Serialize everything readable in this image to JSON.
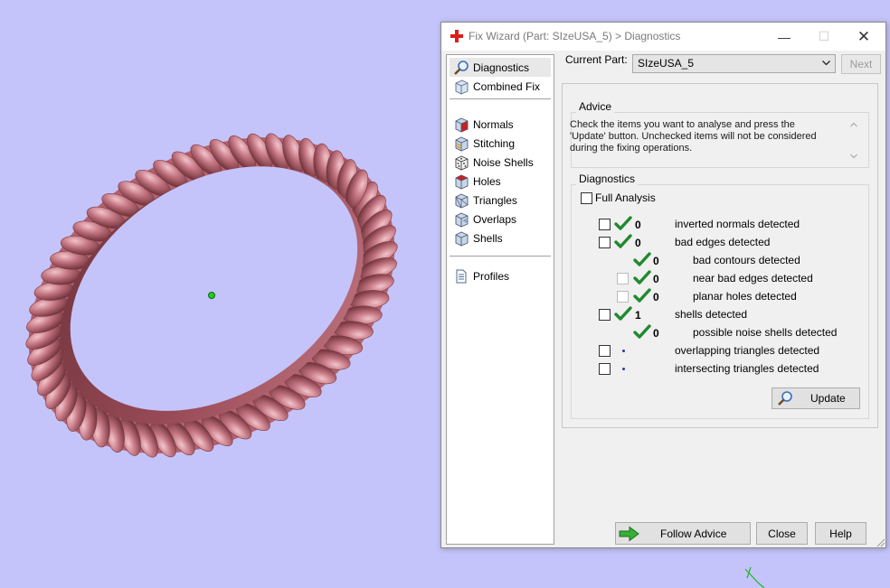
{
  "dialog": {
    "title": "Fix Wizard (Part: SIzeUSA_5) > Diagnostics",
    "window_controls": [
      "minimize-icon",
      "maximize-icon",
      "close-icon"
    ]
  },
  "nav": {
    "items": [
      {
        "label": "Diagnostics",
        "icon": "diagnostics-magnifier-icon",
        "selected": true
      },
      {
        "label": "Combined Fix",
        "icon": "combined-fix-icon"
      },
      {
        "label": "Normals",
        "icon": "normals-cube-icon"
      },
      {
        "label": "Stitching",
        "icon": "stitching-cube-icon"
      },
      {
        "label": "Noise Shells",
        "icon": "noise-shells-dice-icon"
      },
      {
        "label": "Holes",
        "icon": "holes-cube-icon"
      },
      {
        "label": "Triangles",
        "icon": "triangles-icon"
      },
      {
        "label": "Overlaps",
        "icon": "overlaps-cube-icon"
      },
      {
        "label": "Shells",
        "icon": "shells-cube-icon"
      },
      {
        "label": "Profiles",
        "icon": "profiles-document-icon"
      }
    ]
  },
  "current_part": {
    "label": "Current Part:",
    "value": "SIzeUSA_5",
    "next_label": "Next"
  },
  "advice": {
    "title": "Advice",
    "text": "Check the items you want to analyse and press the 'Update' button. Unchecked items will not be considered during the fixing operations."
  },
  "diagnostics": {
    "title": "Diagnostics",
    "full_analysis_label": "Full Analysis",
    "rows": [
      {
        "count": "0",
        "label": "inverted normals detected",
        "status": "ok",
        "checked": false
      },
      {
        "count": "0",
        "label": "bad edges detected",
        "status": "ok",
        "checked": false
      },
      {
        "count": "0",
        "label": "bad contours detected",
        "status": "ok"
      },
      {
        "count": "0",
        "label": "near bad edges detected",
        "status": "ok",
        "checked": false,
        "enabled": false
      },
      {
        "count": "0",
        "label": "planar holes detected",
        "status": "ok",
        "checked": false,
        "enabled": false
      },
      {
        "count": "1",
        "label": "shells detected",
        "status": "ok",
        "checked": false
      },
      {
        "count": "0",
        "label": "possible noise shells detected",
        "status": "ok"
      },
      {
        "count": "",
        "label": "overlapping triangles detected",
        "status": "not-analysed",
        "checked": false
      },
      {
        "count": "",
        "label": "intersecting triangles detected",
        "status": "not-analysed",
        "checked": false
      }
    ],
    "update_label": "Update"
  },
  "footer": {
    "follow_advice_label": "Follow Advice",
    "close_label": "Close",
    "help_label": "Help"
  },
  "colors": {
    "viewport_background": "#c4c4fa",
    "ring": "#c06c78",
    "check_green": "#1f8a2e",
    "follow_arrow_green": "#35b035"
  }
}
